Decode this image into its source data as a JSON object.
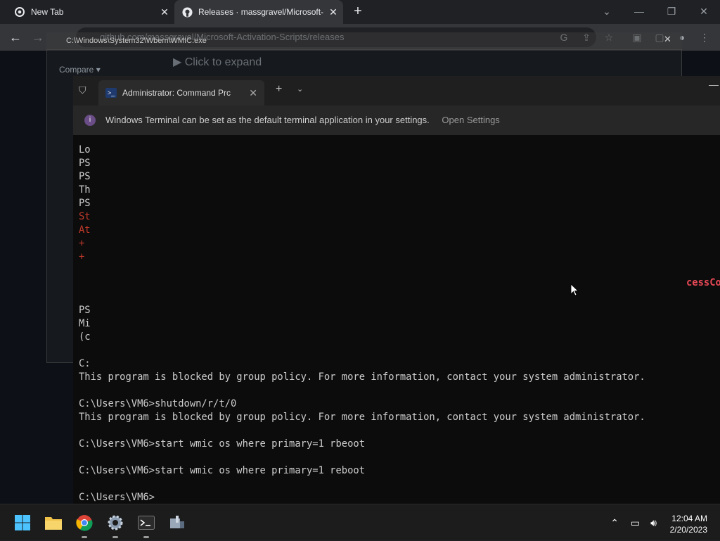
{
  "chrome": {
    "tabs": [
      {
        "label": "New Tab"
      },
      {
        "label": "Releases · massgravel/Microsoft-"
      }
    ],
    "url": "github.com/massgravel/Microsoft-Activation-Scripts/releases"
  },
  "github": {
    "expand_label": "Click to expand",
    "compare_label": "Compare"
  },
  "wmic": {
    "title": "C:\\Windows\\System32\\Wbem\\WMIC.exe"
  },
  "terminal": {
    "tab_title": "Administrator:  Command Prc",
    "info_message": "Windows Terminal can be set as the default terminal application in your settings.",
    "info_action": "Open Settings",
    "clipped_lines": [
      "Lo",
      "PS",
      "PS",
      "Th",
      "PS",
      "St",
      "At",
      "+",
      "+"
    ],
    "clipped_lines_2": [
      "PS",
      "Mi",
      "(c"
    ],
    "right_fragment": "cessCo",
    "lines": [
      "C:",
      "This program is blocked by group policy. For more information, contact your system administrator.",
      "",
      "C:\\Users\\VM6>shutdown/r/t/0",
      "This program is blocked by group policy. For more information, contact your system administrator.",
      "",
      "C:\\Users\\VM6>start wmic os where primary=1 rbeoot",
      "",
      "C:\\Users\\VM6>start wmic os where primary=1 reboot",
      "",
      "C:\\Users\\VM6>"
    ]
  },
  "taskbar": {
    "time": "12:04 AM",
    "date": "2/20/2023"
  }
}
